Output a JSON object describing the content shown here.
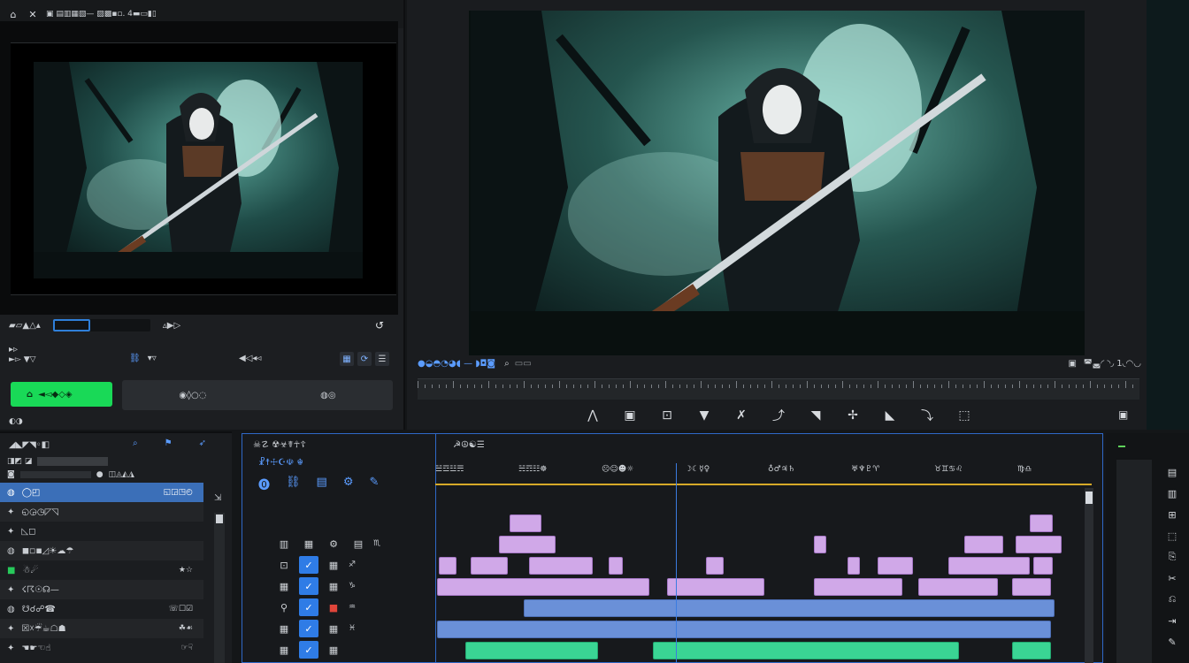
{
  "source_monitor": {
    "toolbar_text": "▣ ▤▥▦▧— ▨▩▪▫. 4▬▭▮▯",
    "range_label": "▰▱▲△▴",
    "range_value": "▵▶▷",
    "sub_header": "▸▹",
    "sub_header_line2": "►▻ ▼▽",
    "sub_item_1": "▾▿",
    "sub_item_2": "◀◁◂◃",
    "render_button": "◄◅◆◇◈",
    "render_panel_a": "◉◊○◌",
    "render_panel_b": "◍◎",
    "small_note": "◐◑"
  },
  "program_monitor": {
    "info_left": "●◒◓◔◕◖ — ◗◘◙",
    "info_right": "◚◛◜ ◝◞ 1◟◠◡",
    "tools": [
      "selection-tool",
      "crop-tool",
      "fit-tool",
      "type-tool",
      "motion-tool",
      "keyframe-tool",
      "effect-tool",
      "magic-tool",
      "camera-tool",
      "audio-tool",
      "transition-tool"
    ]
  },
  "project_panel": {
    "title": "◢◣◤◥◦◧",
    "search_label": "◨◩ ◪",
    "filter_label": "◫◬◭◮",
    "rows": [
      {
        "label": "◯◰",
        "right": "◱◲◳◴",
        "selected": true
      },
      {
        "label": "◵◶◷◸◹",
        "right": ""
      },
      {
        "label": "◺◻",
        "right": ""
      },
      {
        "label": "◼◽◾◿☀☁☂",
        "right": ""
      },
      {
        "label": "☃☄",
        "right": "★☆"
      },
      {
        "label": "☇☈☉☊—",
        "right": ""
      },
      {
        "label": "☋☌☍☎",
        "right": "☏☐☑"
      },
      {
        "label": "☒☓☔☕☖☗",
        "right": "☘☙"
      },
      {
        "label": "☚☛☜☝",
        "right": "☞☟"
      }
    ]
  },
  "timeline": {
    "title": "☠☡ ☢☣☤☥☦",
    "sub_title": "☧☨☩☪☫ ☬",
    "ruler_title": "☭☮☯☰",
    "timecodes": [
      "☱☲☳☴",
      "☵☶☷☸",
      "☹☺☻☼",
      "☽☾☿♀",
      "♁♂♃♄",
      "♅♆♇♈",
      "♉♊♋♌",
      "♍♎"
    ],
    "track_labels": [
      "♏",
      "♐",
      "♑",
      "♒",
      "♓"
    ]
  },
  "colors": {
    "accent_blue": "#2f7ce6",
    "render_green": "#19d957",
    "clip_video": "#d0a8e8",
    "clip_audio": "#6a90d8",
    "clip_green": "#3ad594",
    "playhead": "#3b7be0",
    "ruler_gold": "#d6a928"
  }
}
